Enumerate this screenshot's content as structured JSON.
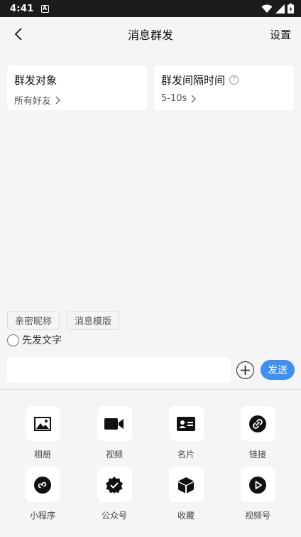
{
  "status_bar": {
    "time": "4:41"
  },
  "header": {
    "title": "消息群发",
    "settings_label": "设置"
  },
  "cards": {
    "target": {
      "title": "群发对象",
      "value": "所有好友"
    },
    "interval": {
      "title": "群发间隔时间",
      "value": "5-10s"
    }
  },
  "tags": [
    "亲密昵称",
    "消息模版"
  ],
  "option": {
    "label": "先发文字"
  },
  "composer": {
    "input_value": "",
    "send_label": "发送"
  },
  "tools": [
    {
      "label": "相册",
      "icon": "image-icon"
    },
    {
      "label": "视频",
      "icon": "video-camera-icon"
    },
    {
      "label": "名片",
      "icon": "contact-card-icon"
    },
    {
      "label": "链接",
      "icon": "link-icon"
    },
    {
      "label": "小程序",
      "icon": "mini-program-icon"
    },
    {
      "label": "公众号",
      "icon": "verified-badge-icon"
    },
    {
      "label": "收藏",
      "icon": "cube-icon"
    },
    {
      "label": "视频号",
      "icon": "play-circle-icon"
    }
  ]
}
